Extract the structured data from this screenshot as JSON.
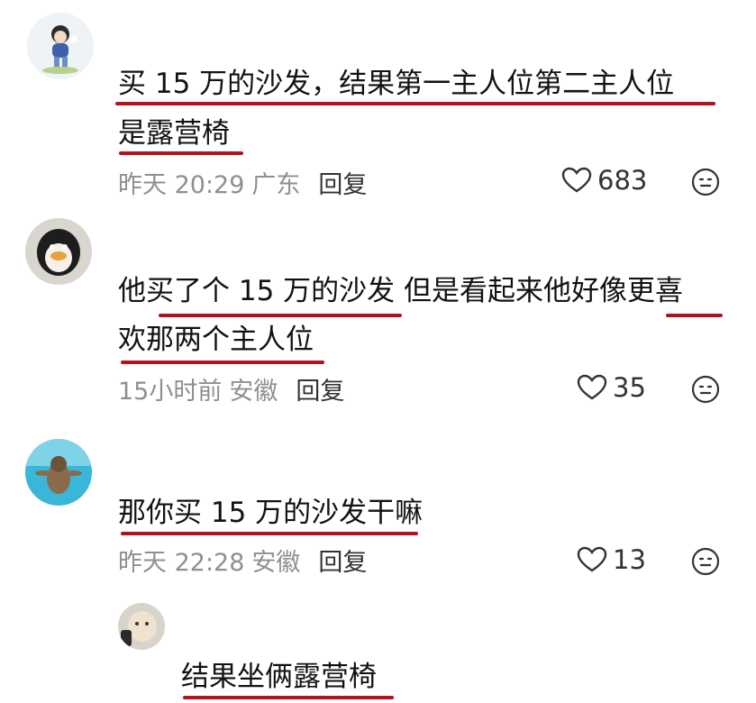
{
  "comments": [
    {
      "text_line1": "买 15 万的沙发，结果第一主人位第二主人位",
      "text_line2": "是露营椅",
      "time": "昨天 20:29",
      "location": "广东",
      "reply_label": "回复",
      "likes": "683"
    },
    {
      "text_line1": "他买了个 15 万的沙发 但是看起来他好像更喜",
      "text_line2": "欢那两个主人位",
      "time": "15小时前",
      "location": "安徽",
      "reply_label": "回复",
      "likes": "35"
    },
    {
      "text_line1": "那你买 15 万的沙发干嘛",
      "time": "昨天 22:28",
      "location": "安徽",
      "reply_label": "回复",
      "likes": "13"
    },
    {
      "text_line1": "结果坐俩露营椅"
    }
  ],
  "colors": {
    "underline": "#b3121c",
    "meta_text": "#8f8f8f"
  },
  "icons": {
    "like": "heart-outline-icon",
    "dislike": "neutral-face-icon"
  }
}
